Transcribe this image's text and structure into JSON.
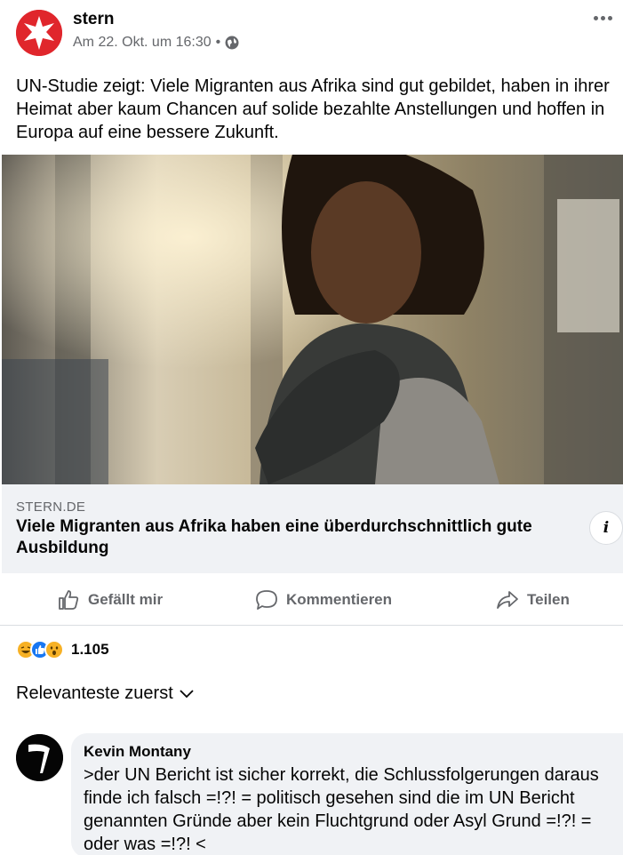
{
  "post": {
    "page_name": "stern",
    "timestamp": "Am 22. Okt. um 16:30",
    "separator": "•",
    "privacy_icon": "globe-icon",
    "text": "UN-Studie zeigt: Viele Migranten aus Afrika sind gut gebildet, haben in ihrer Heimat aber kaum Chancen auf solide bezahlte Anstellungen und hoffen in Europa auf eine bessere Zukunft."
  },
  "link_preview": {
    "domain": "STERN.DE",
    "title": "Viele Migranten aus Afrika haben eine überdurchschnittlich gute Ausbildung",
    "info_label": "i"
  },
  "actions": {
    "like": "Gefällt mir",
    "comment": "Kommentieren",
    "share": "Teilen"
  },
  "reactions": {
    "icons": [
      "haha-reaction-icon",
      "like-reaction-icon",
      "wow-reaction-icon"
    ],
    "count": "1.105"
  },
  "comments_sort": {
    "label": "Relevanteste zuerst"
  },
  "comment": {
    "author": "Kevin Montany",
    "text": ">der UN Bericht ist sicher korrekt, die Schlussfolgerungen daraus finde ich falsch =!?! = politisch gesehen sind die im UN Bericht genannten Gründe aber kein Fluchtgrund oder Asyl Grund =!?! = oder was =!?! <"
  },
  "colors": {
    "brand_red": "#e0262c",
    "muted_text": "#65676b",
    "bubble_bg": "#f0f2f5",
    "like_blue": "#1877f2",
    "reaction_yellow": "#f7b125"
  }
}
